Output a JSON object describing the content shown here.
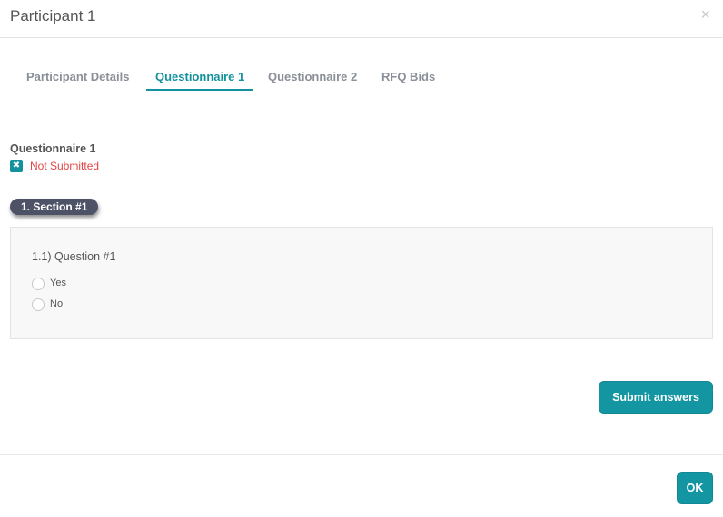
{
  "modal": {
    "title": "Participant 1",
    "close_glyph": "×"
  },
  "tabs": [
    {
      "label": "Participant Details",
      "active": false
    },
    {
      "label": "Questionnaire 1",
      "active": true
    },
    {
      "label": "Questionnaire 2",
      "active": false
    },
    {
      "label": "RFQ Bids",
      "active": false
    }
  ],
  "questionnaire": {
    "title": "Questionnaire 1",
    "status_icon": "x-box-icon",
    "status_glyph": "✖",
    "status_text": "Not Submitted",
    "section_label": "1. Section #1",
    "question": "1.1) Question #1",
    "options": [
      {
        "label": "Yes",
        "selected": false
      },
      {
        "label": "No",
        "selected": false
      }
    ],
    "submit_label": "Submit answers"
  },
  "footer": {
    "ok_label": "OK"
  },
  "colors": {
    "accent": "#13929e",
    "error": "#e24444",
    "section_pill": "#4d5266"
  }
}
